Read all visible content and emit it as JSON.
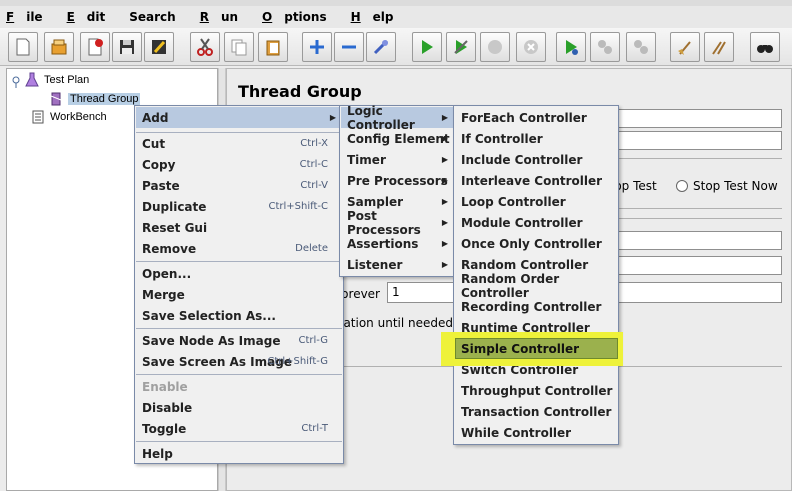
{
  "menubar": [
    {
      "ul": "F",
      "rest": "ile"
    },
    {
      "ul": "E",
      "rest": "dit"
    },
    {
      "ul": "",
      "rest": "Search"
    },
    {
      "ul": "R",
      "rest": "un"
    },
    {
      "ul": "O",
      "rest": "ptions"
    },
    {
      "ul": "H",
      "rest": "elp"
    }
  ],
  "tree": {
    "test_plan": "Test Plan",
    "thread_group": "Thread Group",
    "workbench": "WorkBench"
  },
  "panel": {
    "title": "Thread Group",
    "stop_test": "Stop Test",
    "stop_test_now": "Stop Test Now",
    "forever": "Forever",
    "loop_value": "1",
    "delay_creation": "Delay Thread creation until needed"
  },
  "context_menu": {
    "add": "Add",
    "cut": "Cut",
    "cut_acc": "Ctrl-X",
    "copy": "Copy",
    "copy_acc": "Ctrl-C",
    "paste": "Paste",
    "paste_acc": "Ctrl-V",
    "duplicate": "Duplicate",
    "duplicate_acc": "Ctrl+Shift-C",
    "reset_gui": "Reset Gui",
    "remove": "Remove",
    "remove_acc": "Delete",
    "open": "Open...",
    "merge": "Merge",
    "save_selection": "Save Selection As...",
    "save_node_image": "Save Node As Image",
    "save_node_acc": "Ctrl-G",
    "save_screen_image": "Save Screen As Image",
    "save_screen_acc": "Ctrl+Shift-G",
    "enable": "Enable",
    "disable": "Disable",
    "toggle": "Toggle",
    "toggle_acc": "Ctrl-T",
    "help": "Help"
  },
  "add_submenu": {
    "logic_controller": "Logic Controller",
    "config_element": "Config Element",
    "timer": "Timer",
    "pre_processors": "Pre Processors",
    "sampler": "Sampler",
    "post_processors": "Post Processors",
    "assertions": "Assertions",
    "listener": "Listener"
  },
  "logic_submenu": [
    "ForEach Controller",
    "If Controller",
    "Include Controller",
    "Interleave Controller",
    "Loop Controller",
    "Module Controller",
    "Once Only Controller",
    "Random Controller",
    "Random Order Controller",
    "Recording Controller",
    "Runtime Controller",
    "Simple Controller",
    "Switch Controller",
    "Throughput Controller",
    "Transaction Controller",
    "While Controller"
  ],
  "colors": {
    "highlight": "#eef23a",
    "selected_item": "#9bb14d",
    "menu_active": "#b8c9e0"
  }
}
